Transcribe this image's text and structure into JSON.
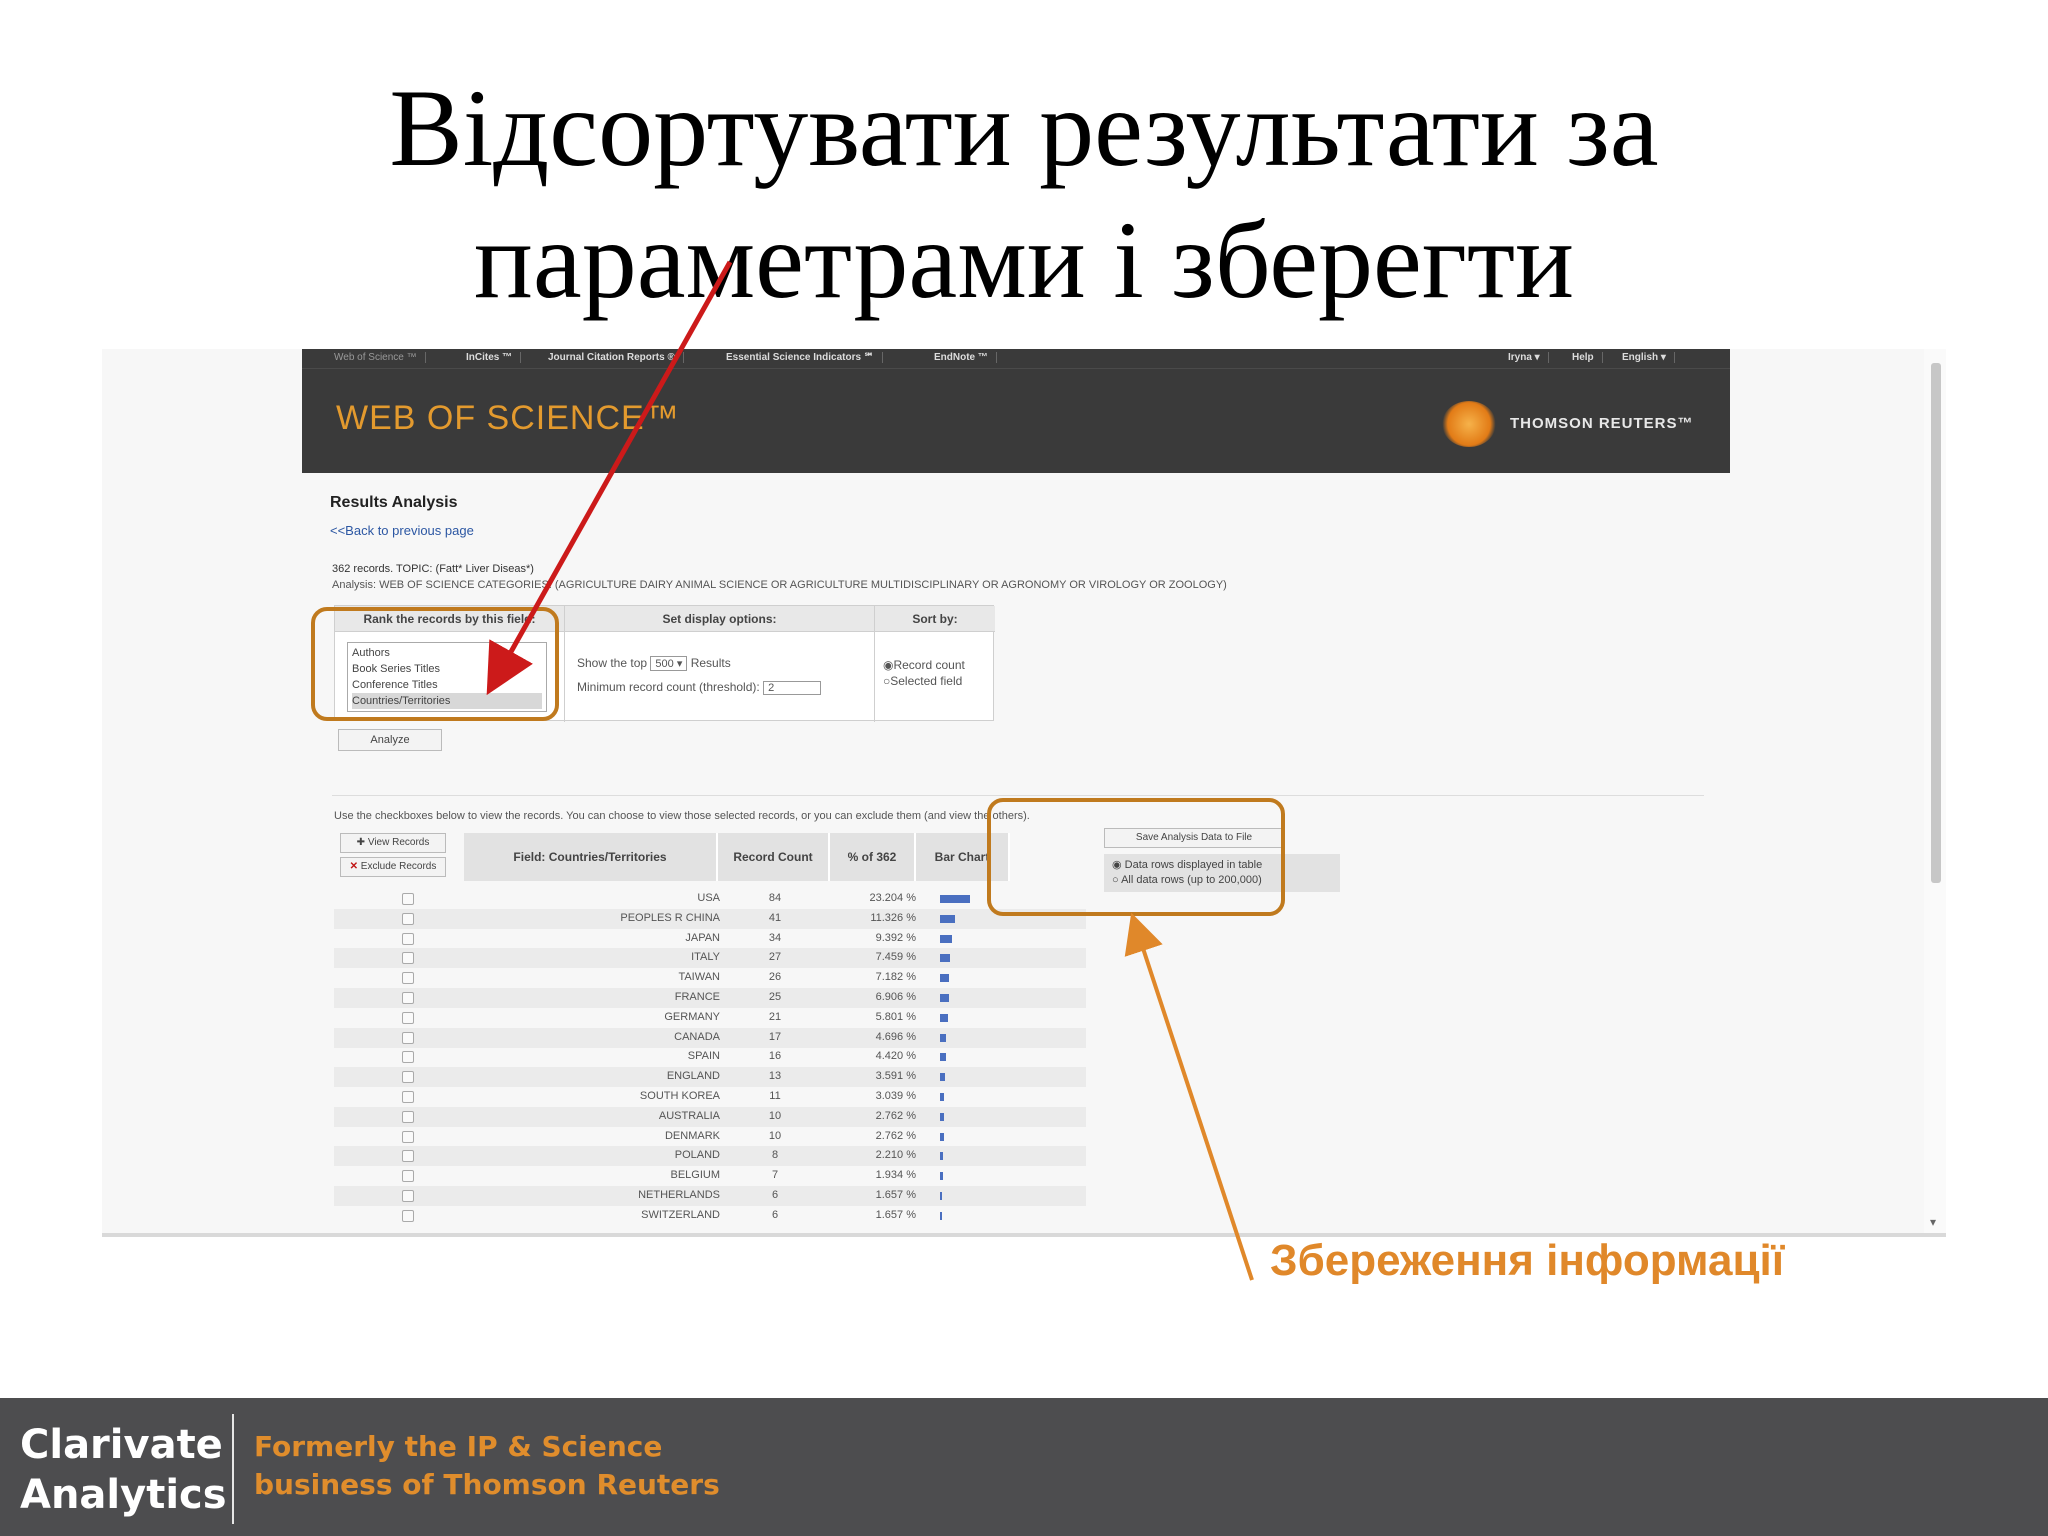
{
  "slide": {
    "title_line1": "Відсортувати результати за",
    "title_line2": "параметрами і зберегти",
    "caption": "Збереження інформації"
  },
  "wos": {
    "nav": [
      "Web of Science ™",
      "InCites ™",
      "Journal Citation Reports ®",
      "Essential Science Indicators ℠",
      "EndNote ™"
    ],
    "nav_right": [
      "Iryna ▾",
      "Help",
      "English ▾"
    ],
    "logo": "WEB OF SCIENCE™",
    "publisher": "THOMSON REUTERS™"
  },
  "analysis": {
    "heading": "Results Analysis",
    "back_link": "<<Back to previous page",
    "records_line": "362 records. TOPIC: (Fatt* Liver Diseas*)",
    "analysis_line": "Analysis: WEB OF SCIENCE CATEGORIES: (AGRICULTURE DAIRY ANIMAL SCIENCE OR AGRICULTURE MULTIDISCIPLINARY OR AGRONOMY OR VIROLOGY OR ZOOLOGY)",
    "rank_header": "Rank the records by this field:",
    "rank_options": [
      "Authors",
      "Book Series Titles",
      "Conference Titles",
      "Countries/Territories"
    ],
    "display_header": "Set display options:",
    "show_top_prefix": "Show the top",
    "show_top_value": "500 ▾",
    "show_top_suffix": "Results",
    "min_count_label": "Minimum record count (threshold):",
    "min_count_value": "2",
    "sort_header": "Sort by:",
    "sort_options": [
      "◉Record count",
      "○Selected field"
    ],
    "analyze_button": "Analyze",
    "instructions": "Use the checkboxes below to view the records. You can choose to view those selected records, or you can exclude them (and view the others).",
    "view_records": "View Records",
    "exclude_records": "Exclude Records",
    "columns": [
      "Field: Countries/Territories",
      "Record Count",
      "% of 362",
      "Bar Chart"
    ],
    "save_button": "Save Analysis Data to File",
    "save_options": [
      "◉ Data rows displayed in table",
      "○ All data rows (up to 200,000)"
    ]
  },
  "rows": [
    {
      "country": "USA",
      "count": "84",
      "pct": "23.204 %",
      "share": 23.204
    },
    {
      "country": "PEOPLES R CHINA",
      "count": "41",
      "pct": "11.326 %",
      "share": 11.326
    },
    {
      "country": "JAPAN",
      "count": "34",
      "pct": "9.392 %",
      "share": 9.392
    },
    {
      "country": "ITALY",
      "count": "27",
      "pct": "7.459 %",
      "share": 7.459
    },
    {
      "country": "TAIWAN",
      "count": "26",
      "pct": "7.182 %",
      "share": 7.182
    },
    {
      "country": "FRANCE",
      "count": "25",
      "pct": "6.906 %",
      "share": 6.906
    },
    {
      "country": "GERMANY",
      "count": "21",
      "pct": "5.801 %",
      "share": 5.801
    },
    {
      "country": "CANADA",
      "count": "17",
      "pct": "4.696 %",
      "share": 4.696
    },
    {
      "country": "SPAIN",
      "count": "16",
      "pct": "4.420 %",
      "share": 4.42
    },
    {
      "country": "ENGLAND",
      "count": "13",
      "pct": "3.591 %",
      "share": 3.591
    },
    {
      "country": "SOUTH KOREA",
      "count": "11",
      "pct": "3.039 %",
      "share": 3.039
    },
    {
      "country": "AUSTRALIA",
      "count": "10",
      "pct": "2.762 %",
      "share": 2.762
    },
    {
      "country": "DENMARK",
      "count": "10",
      "pct": "2.762 %",
      "share": 2.762
    },
    {
      "country": "POLAND",
      "count": "8",
      "pct": "2.210 %",
      "share": 2.21
    },
    {
      "country": "BELGIUM",
      "count": "7",
      "pct": "1.934 %",
      "share": 1.934
    },
    {
      "country": "NETHERLANDS",
      "count": "6",
      "pct": "1.657 %",
      "share": 1.657
    },
    {
      "country": "SWITZERLAND",
      "count": "6",
      "pct": "1.657 %",
      "share": 1.657
    }
  ],
  "footer": {
    "brand_line1": "Clarivate",
    "brand_line2": "Analytics",
    "formerly_line1": "Formerly the IP & Science",
    "formerly_line2": "business of Thomson Reuters"
  },
  "colors": {
    "accent_orange": "#e0882a",
    "highlight_box": "#c07a1e",
    "red_arrow": "#cc1a1a",
    "wos_header": "#3a3a3a",
    "footer_bg": "#4d4d4f",
    "bar_blue": "#4a6fc0"
  }
}
